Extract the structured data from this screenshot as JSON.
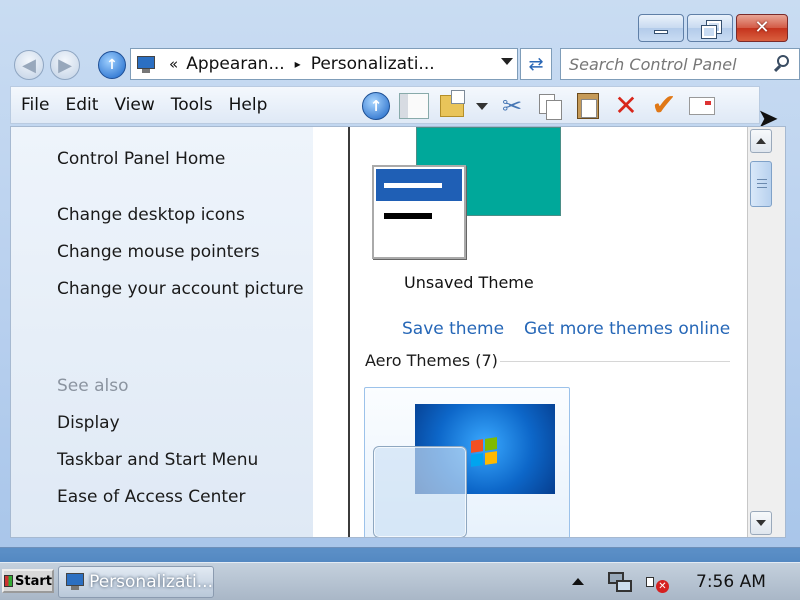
{
  "window": {
    "caption_buttons": {
      "minimize_icon": "minimize-icon",
      "restore_icon": "restore-icon",
      "close_icon": "close-icon"
    }
  },
  "address_bar": {
    "overflow": "«",
    "crumbs": [
      "Appearan...",
      "Personalizati..."
    ],
    "separator": "▸"
  },
  "search": {
    "placeholder": "Search Control Panel"
  },
  "menu": [
    "File",
    "Edit",
    "View",
    "Tools",
    "Help"
  ],
  "toolbar_icons": [
    "up-icon",
    "preview-pane-icon",
    "folder-options-icon",
    "dropdown-icon",
    "cut-icon",
    "copy-icon",
    "paste-icon",
    "delete-icon",
    "check-icon",
    "properties-icon"
  ],
  "left_pane": {
    "home": "Control Panel Home",
    "tasks": [
      "Change desktop icons",
      "Change mouse pointers",
      "Change your account picture"
    ],
    "see_also_heading": "See also",
    "see_also": [
      "Display",
      "Taskbar and Start Menu",
      "Ease of Access Center"
    ]
  },
  "main": {
    "current_theme_name": "Unsaved Theme",
    "save_theme": "Save theme",
    "get_more_themes": "Get more themes online",
    "aero_section": "Aero Themes (7)",
    "accent_color": "#00a89a"
  },
  "taskbar": {
    "start_label": "Start",
    "task_label": "Personalizati...",
    "clock": "7:56 AM"
  }
}
